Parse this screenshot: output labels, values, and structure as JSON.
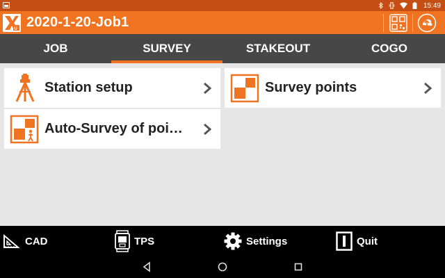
{
  "status_bar": {
    "time": "15:49"
  },
  "header": {
    "title": "2020-1-20-Job1"
  },
  "tabs": [
    {
      "label": "JOB"
    },
    {
      "label": "SURVEY"
    },
    {
      "label": "STAKEOUT"
    },
    {
      "label": "COGO"
    }
  ],
  "active_tab": "SURVEY",
  "cards": {
    "station_setup": "Station setup",
    "auto_survey": "Auto-Survey of points",
    "survey_points": "Survey points"
  },
  "bottom_bar": {
    "cad": "CAD",
    "tps": "TPS",
    "settings": "Settings",
    "quit": "Quit"
  },
  "colors": {
    "accent": "#ef7320",
    "status_bar": "#c44e14",
    "tab_bar": "#474747",
    "toolbar": "#000000"
  },
  "icons": {
    "station_setup": "tripod-icon",
    "auto_survey": "auto-survey-icon",
    "survey_points": "survey-points-icon",
    "cad": "set-square-icon",
    "tps": "total-station-icon",
    "settings": "gear-icon",
    "quit": "quit-icon"
  }
}
